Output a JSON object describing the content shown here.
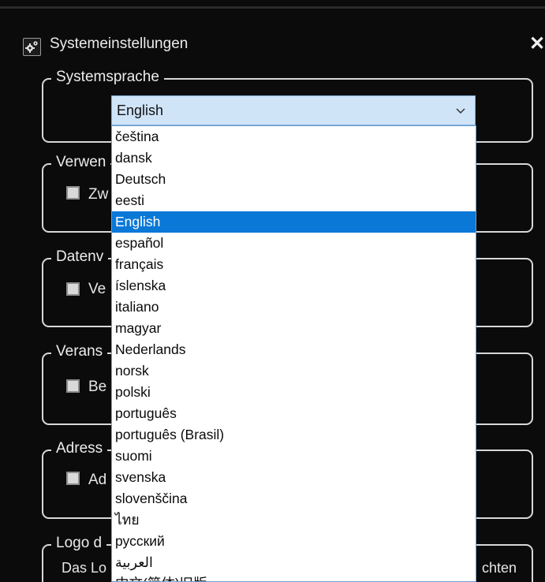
{
  "window": {
    "title": "Systemeinstellungen",
    "close_symbol": "✕",
    "icon": "gear-icon"
  },
  "groups": [
    {
      "title": "Systemsprache"
    },
    {
      "title": "Verwen",
      "checkbox_label": "Zw"
    },
    {
      "title": "Datenv",
      "checkbox_label": "Ve"
    },
    {
      "title": "Verans",
      "checkbox_label": "Be"
    },
    {
      "title": "Adress",
      "checkbox_label": "Ad"
    },
    {
      "title": "Logo d",
      "text_left": "Das Lo",
      "text_right": "chten"
    }
  ],
  "language_select": {
    "value": "English",
    "icon": "chevron-down-icon",
    "options": [
      "čeština",
      "dansk",
      "Deutsch",
      "eesti",
      "English",
      "español",
      "français",
      "íslenska",
      "italiano",
      "magyar",
      "Nederlands",
      "norsk",
      "polski",
      "português",
      "português (Brasil)",
      "suomi",
      "svenska",
      "slovenščina",
      "ไทย",
      "русский",
      "العربية",
      "中文(简体)旧版"
    ],
    "selected_index": 4
  },
  "colors": {
    "background": "#0b0b0b",
    "selected": "#0a78d7",
    "select_field": "#cfe4f7"
  }
}
